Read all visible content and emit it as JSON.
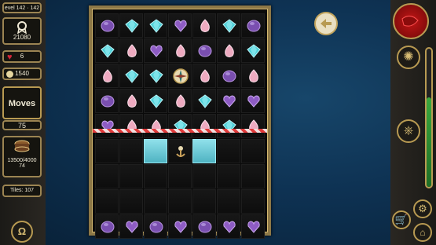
{
  "left_panel": {
    "level_label": "evel 142 · 142",
    "score": "21080",
    "lives": "6",
    "coins": "1540",
    "moves_label": "Moves",
    "moves_value": "75",
    "target_label": "13500/4000",
    "target_sub": "74",
    "tiles_label": "Tiles: 107"
  },
  "right_panel": {
    "progress_fraction": 0.65
  },
  "board": {
    "rows": [
      [
        "purple-oval",
        "teal-diamond",
        "teal-diamond",
        "purple-heart",
        "pink-drop",
        "teal-diamond",
        "purple-oval"
      ],
      [
        "teal-diamond",
        "pink-drop",
        "purple-heart",
        "pink-drop",
        "purple-oval",
        "pink-drop",
        "teal-diamond"
      ],
      [
        "pink-drop",
        "teal-diamond",
        "teal-diamond",
        "compass",
        "pink-drop",
        "purple-oval",
        "pink-drop"
      ],
      [
        "purple-oval",
        "pink-drop",
        "teal-diamond",
        "pink-drop",
        "teal-diamond",
        "purple-heart",
        "purple-heart"
      ],
      [
        "purple-heart",
        "pink-drop",
        "pink-drop",
        "teal-diamond",
        "pink-drop",
        "teal-diamond",
        "pink-drop"
      ],
      [
        "empty",
        "empty",
        "blue",
        "anchor",
        "blue",
        "empty",
        "empty"
      ],
      [
        "empty",
        "empty",
        "empty",
        "empty",
        "empty",
        "empty",
        "empty"
      ],
      [
        "empty",
        "empty",
        "empty",
        "empty",
        "empty",
        "empty",
        "empty"
      ],
      [
        "purple-oval",
        "purple-heart",
        "purple-oval",
        "purple-heart",
        "purple-oval",
        "purple-heart",
        "purple-heart"
      ]
    ]
  },
  "colors": {
    "teal": "#4fd0d8",
    "pink": "#eeaac0",
    "purple": "#7a4fb0",
    "gold": "#b89a52"
  }
}
